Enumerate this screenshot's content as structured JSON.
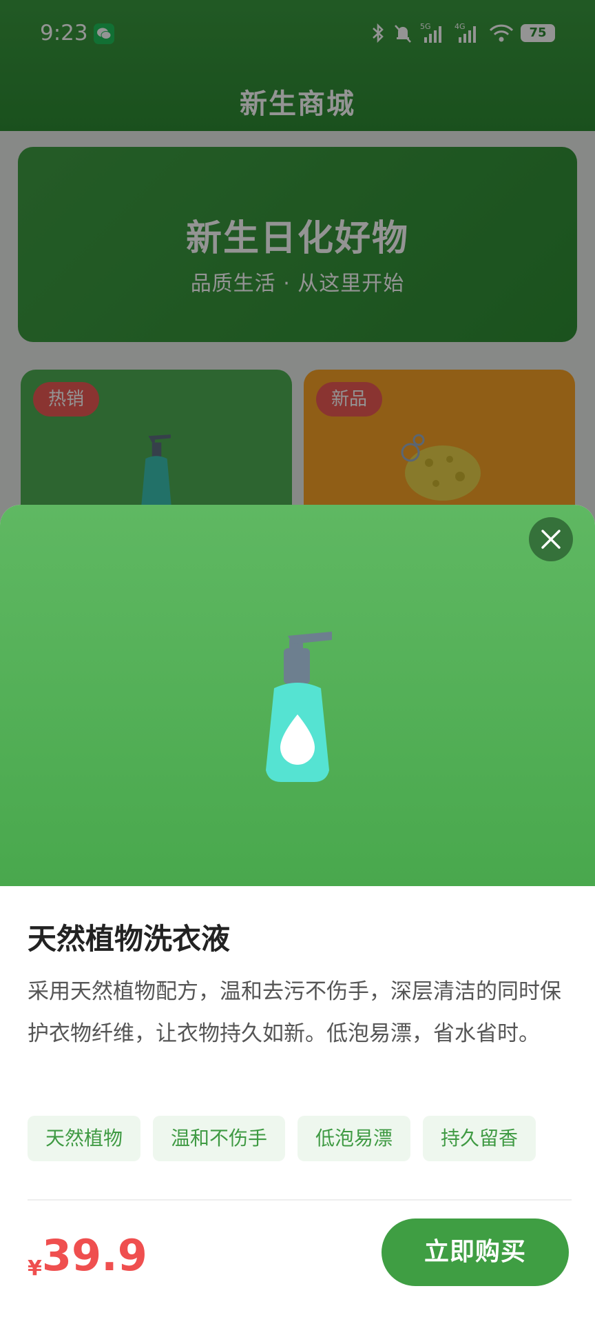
{
  "status_bar": {
    "time": "9:23",
    "network_1": "5G",
    "network_2": "4G",
    "battery": "75"
  },
  "header": {
    "title": "新生商城"
  },
  "banner": {
    "title": "新生日化好物",
    "subtitle": "品质生活 · 从这里开始"
  },
  "products": [
    {
      "badge": "热销",
      "icon": "soap-bottle-icon",
      "color": "#4fae54"
    },
    {
      "badge": "新品",
      "icon": "sponge-icon",
      "color": "#f8a326"
    }
  ],
  "detail": {
    "name": "天然植物洗衣液",
    "description": "采用天然植物配方，温和去污不伤手，深层清洁的同时保护衣物纤维，让衣物持久如新。低泡易漂，省水省时。",
    "tags": [
      "天然植物",
      "温和不伤手",
      "低泡易漂",
      "持久留香"
    ],
    "currency": "¥",
    "price": "39.9",
    "buy_label": "立即购买",
    "hero_icon": "soap-bottle-icon"
  },
  "colors": {
    "brand_green": "#3f9e43",
    "price_red": "#ef4f4f",
    "badge_red": "#ee5a55",
    "tag_bg": "#eef7ee"
  }
}
